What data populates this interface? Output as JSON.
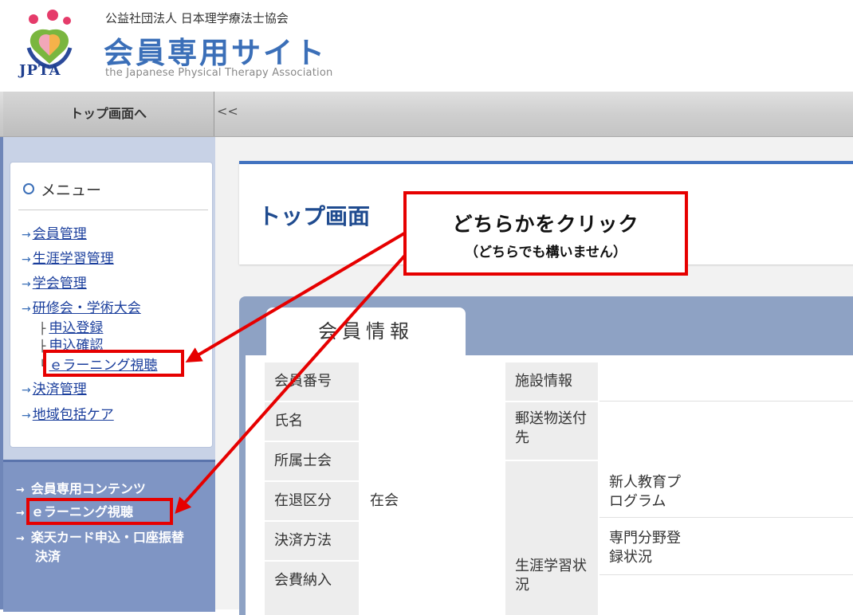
{
  "header": {
    "org_name": "公益社団法人 日本理学療法士協会",
    "site_title": "会員専用サイト",
    "site_subtitle": "the Japanese Physical Therapy Association",
    "logo_text": "JPTA",
    "brand_color": "#3b6fb8"
  },
  "topbar": {
    "top_button": "トップ画面へ",
    "collapse": "<<"
  },
  "sidebar": {
    "menu_title": "メニュー",
    "items": [
      {
        "label": "会員管理"
      },
      {
        "label": "生涯学習管理"
      },
      {
        "label": "学会管理"
      },
      {
        "label": "研修会・学術大会"
      },
      {
        "label": "決済管理"
      },
      {
        "label": "地域包括ケア"
      }
    ],
    "sub_items": [
      {
        "label": "申込登録"
      },
      {
        "label": "申込確認"
      },
      {
        "label": "ｅラーニング視聴"
      }
    ],
    "contents": [
      {
        "label": "会員専用コンテンツ"
      },
      {
        "label": "ｅラーニング視聴"
      },
      {
        "label": "楽天カード申込・口座振替"
      },
      {
        "label": "決済"
      }
    ]
  },
  "main": {
    "page_title": "トップ画面",
    "info_tab": "会員情報",
    "fields_left": [
      {
        "label": "会員番号",
        "value": ""
      },
      {
        "label": "氏名",
        "value": ""
      },
      {
        "label": "所属士会",
        "value": ""
      },
      {
        "label": "在退区分",
        "value": "在会"
      },
      {
        "label": "決済方法",
        "value": ""
      },
      {
        "label": "会費納入",
        "value": ""
      }
    ],
    "fields_right": [
      {
        "label": "施設情報"
      },
      {
        "label": "郵送物送付先"
      },
      {
        "label": "生涯学習状況"
      }
    ],
    "sub_fields": [
      {
        "label": "新人教育プログラム"
      },
      {
        "label": "専門分野登録状況"
      }
    ]
  },
  "callout": {
    "line1": "どちらかをクリック",
    "line2": "（どちらでも構いません）",
    "color": "#e60000"
  }
}
